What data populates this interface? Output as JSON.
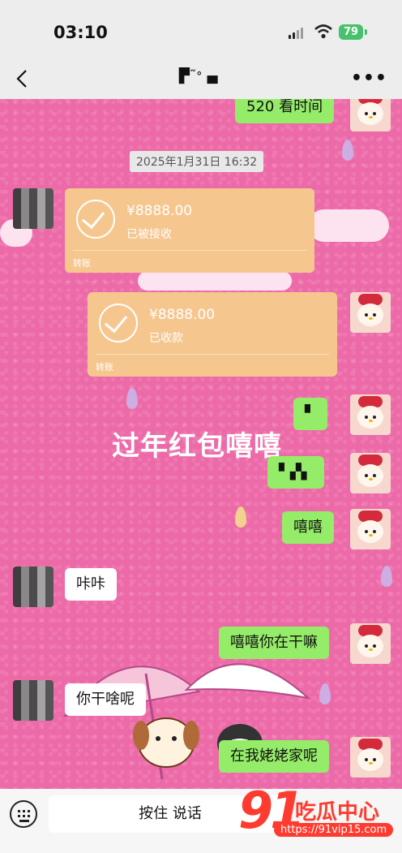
{
  "status_bar": {
    "time": "03:10",
    "battery": "79"
  },
  "header": {
    "title": "▛˜ᐤ▗▖"
  },
  "chat": {
    "top_partial_message": "520 看时间",
    "timestamp": "2025年1月31日 16:32",
    "transfer_received": {
      "amount": "¥8888.00",
      "status": "已被接收",
      "label": "转账"
    },
    "transfer_sent": {
      "amount": "¥8888.00",
      "status": "已收款",
      "label": "转账"
    },
    "overlay_caption": "过年红包嘻嘻",
    "msg_obscured_1": "▘",
    "msg_obscured_2": "▘▞▖",
    "msg_xixi": "嘻嘻",
    "msg_kaka": "咔咔",
    "msg_what_doing": "嘻嘻你在干嘛",
    "msg_you_doing": "你干啥呢",
    "msg_at_grandma": "在我姥姥家呢"
  },
  "input_bar": {
    "hold_to_talk": "按住 说话"
  },
  "watermark": {
    "brand": "91",
    "text": "吃瓜中心",
    "url": "https://91vip15.com"
  },
  "icons": {
    "back": "chevron-left-icon",
    "more": "ellipsis-icon",
    "keyboard": "keyboard-icon"
  }
}
